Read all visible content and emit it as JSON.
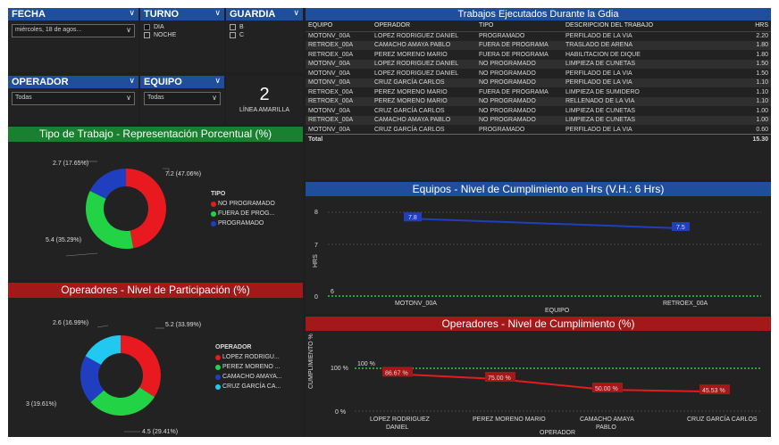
{
  "filters": {
    "fecha": {
      "label": "FECHA",
      "value": "miércoles, 18 de agos..."
    },
    "turno": {
      "label": "TURNO",
      "options": [
        "DIA",
        "NOCHE"
      ]
    },
    "guardia": {
      "label": "GUARDIA",
      "options": [
        "B",
        "C"
      ]
    },
    "operador": {
      "label": "OPERADOR",
      "value": "Todas"
    },
    "equipo": {
      "label": "EQUIPO",
      "value": "Todas"
    }
  },
  "card": {
    "value": "2",
    "label": "LÍNEA AMARILLA"
  },
  "tipo_trabajo": {
    "title": "Tipo de Trabajo - Representación Porcentual (%)",
    "legend_title": "TIPO",
    "legend": [
      "NO PROGRAMADO",
      "FUERA DE PROG...",
      "PROGRAMADO"
    ],
    "labels": [
      "7.2 (47.06%)",
      "5.4 (35.29%)",
      "2.7 (17.65%)"
    ],
    "colors": [
      "#e8191f",
      "#22d345",
      "#1f3fc0"
    ]
  },
  "operadores_part": {
    "title": "Operadores - Nivel de Participación (%)",
    "legend_title": "OPERADOR",
    "legend": [
      "LOPEZ RODRIGU...",
      "PEREZ MORENO ...",
      "CAMACHO AMAYA...",
      "CRUZ GARCÍA CA..."
    ],
    "labels": [
      "5.2 (33.99%)",
      "4.5 (29.41%)",
      "3 (19.61%)",
      "2.6 (16.99%)"
    ],
    "colors": [
      "#e8191f",
      "#22d345",
      "#1f3fc0",
      "#21c8ef"
    ]
  },
  "trabajos": {
    "title": "Trabajos Ejecutados Durante la Gdia",
    "headers": [
      "EQUIPO",
      "OPERADOR",
      "TIPO",
      "DESCRIPCION DEL TRABAJO",
      "HRS"
    ],
    "rows": [
      [
        "MOTONV_00A",
        "LOPEZ RODRIGUEZ DANIEL",
        "PROGRAMADO",
        "PERFILADO DE LA VIA",
        "2.20"
      ],
      [
        "RETROEX_00A",
        "CAMACHO AMAYA PABLO",
        "FUERA DE PROGRAMA",
        "TRASLADO DE ARENA",
        "1.80"
      ],
      [
        "RETROEX_00A",
        "PEREZ MORENO MARIO",
        "FUERA DE PROGRAMA",
        "HABILITACION DE DIQUE",
        "1.80"
      ],
      [
        "MOTONV_00A",
        "LOPEZ RODRIGUEZ DANIEL",
        "NO PROGRAMADO",
        "LIMPIEZA DE CUNETAS",
        "1.50"
      ],
      [
        "MOTONV_00A",
        "LOPEZ RODRIGUEZ DANIEL",
        "NO PROGRAMADO",
        "PERFILADO DE LA VIA",
        "1.50"
      ],
      [
        "MOTONV_00A",
        "CRUZ GARCÍA CARLOS",
        "NO PROGRAMADO",
        "PERFILADO DE LA VIA",
        "1.10"
      ],
      [
        "RETROEX_00A",
        "PEREZ MORENO MARIO",
        "FUERA DE PROGRAMA",
        "LIMPIEZA DE SUMIDERO",
        "1.10"
      ],
      [
        "RETROEX_00A",
        "PEREZ MORENO MARIO",
        "NO PROGRAMADO",
        "RELLENADO DE LA VIA",
        "1.10"
      ],
      [
        "MOTONV_00A",
        "CRUZ GARCÍA CARLOS",
        "NO PROGRAMADO",
        "LIMPIEZA DE CUNETAS",
        "1.00"
      ],
      [
        "RETROEX_00A",
        "CAMACHO AMAYA PABLO",
        "NO PROGRAMADO",
        "LIMPIEZA DE CUNETAS",
        "1.00"
      ],
      [
        "MOTONV_00A",
        "CRUZ GARCÍA CARLOS",
        "PROGRAMADO",
        "PERFILADO DE LA VIA",
        "0.60"
      ]
    ],
    "total_label": "Total",
    "total_value": "15.30"
  },
  "chart_data": [
    {
      "type": "pie",
      "title": "Tipo de Trabajo - Representación Porcentual (%)",
      "categories": [
        "NO PROGRAMADO",
        "FUERA DE PROG...",
        "PROGRAMADO"
      ],
      "values": [
        7.2,
        5.4,
        2.7
      ],
      "percent_labels": [
        "47.06%",
        "35.29%",
        "17.65%"
      ],
      "donut": true
    },
    {
      "type": "pie",
      "title": "Operadores - Nivel de Participación (%)",
      "categories": [
        "LOPEZ RODRIGU...",
        "PEREZ MORENO ...",
        "CAMACHO AMAYA...",
        "CRUZ GARCÍA CA..."
      ],
      "values": [
        5.2,
        4.5,
        3,
        2.6
      ],
      "percent_labels": [
        "33.99%",
        "29.41%",
        "19.61%",
        "16.99%"
      ],
      "donut": true
    },
    {
      "type": "line",
      "title": "Equipos - Nivel de Cumplimiento en Hrs (V.H.: 6 Hrs)",
      "categories": [
        "MOTONV_00A",
        "RETROEX_00A"
      ],
      "series": [
        {
          "values": [
            7.8,
            7.5
          ]
        }
      ],
      "point_labels": [
        "7.8",
        "7.5"
      ],
      "reference_value": 6,
      "reference_label": "6",
      "xlabel": "EQUIPO",
      "ylabel": "HRS",
      "y_ticks": [
        "8",
        "7",
        "0"
      ]
    },
    {
      "type": "line",
      "title": "Operadores - Nivel de Cumplimiento (%)",
      "categories": [
        "LOPEZ RODRIGUEZ DANIEL",
        "PEREZ MORENO MARIO",
        "CAMACHO AMAYA PABLO",
        "CRUZ GARCÍA CARLOS"
      ],
      "series": [
        {
          "values": [
            86.67,
            75.0,
            50.0,
            45.53
          ]
        }
      ],
      "point_labels": [
        "86.67 %",
        "75.00 %",
        "50.00 %",
        "45.53 %"
      ],
      "reference_value": 100,
      "reference_label": "100 %",
      "xlabel": "OPERADOR",
      "ylabel": "CUMPLIMIENTO %",
      "y_ticks": [
        "100 %",
        "0 %"
      ]
    }
  ],
  "colors": {
    "red": "#e8191f",
    "green": "#22d345",
    "blue": "#1f3fc0",
    "cyan": "#21c8ef",
    "header_blue": "#1f4e9c",
    "header_red": "#a31818",
    "header_green": "#18802e"
  }
}
